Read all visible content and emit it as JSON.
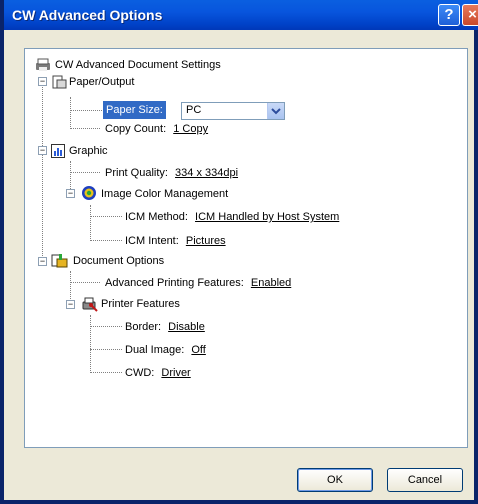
{
  "window": {
    "title": "CW Advanced Options",
    "help_glyph": "?",
    "close_glyph": "×"
  },
  "tree": {
    "root": {
      "label": "CW Advanced Document Settings"
    },
    "paper_output": {
      "label": "Paper/Output",
      "paper_size": {
        "label": "Paper Size:",
        "value": "PC"
      },
      "copy_count": {
        "label": "Copy Count:",
        "value": "1 Copy"
      }
    },
    "graphic": {
      "label": "Graphic",
      "print_quality": {
        "label": "Print Quality:",
        "value": "334 x 334dpi"
      },
      "icm": {
        "label": "Image Color Management",
        "method": {
          "label": "ICM Method:",
          "value": "ICM Handled by Host System"
        },
        "intent": {
          "label": "ICM Intent:",
          "value": "Pictures"
        }
      }
    },
    "document_options": {
      "label": "Document Options",
      "advanced_printing": {
        "label": "Advanced Printing Features:",
        "value": "Enabled"
      },
      "printer_features": {
        "label": "Printer Features",
        "border": {
          "label": "Border:",
          "value": "Disable"
        },
        "dual_image": {
          "label": "Dual Image:",
          "value": "Off"
        },
        "cwd": {
          "label": "CWD:",
          "value": "Driver"
        }
      }
    },
    "expander_glyph": "−"
  },
  "buttons": {
    "ok": "OK",
    "cancel": "Cancel"
  }
}
